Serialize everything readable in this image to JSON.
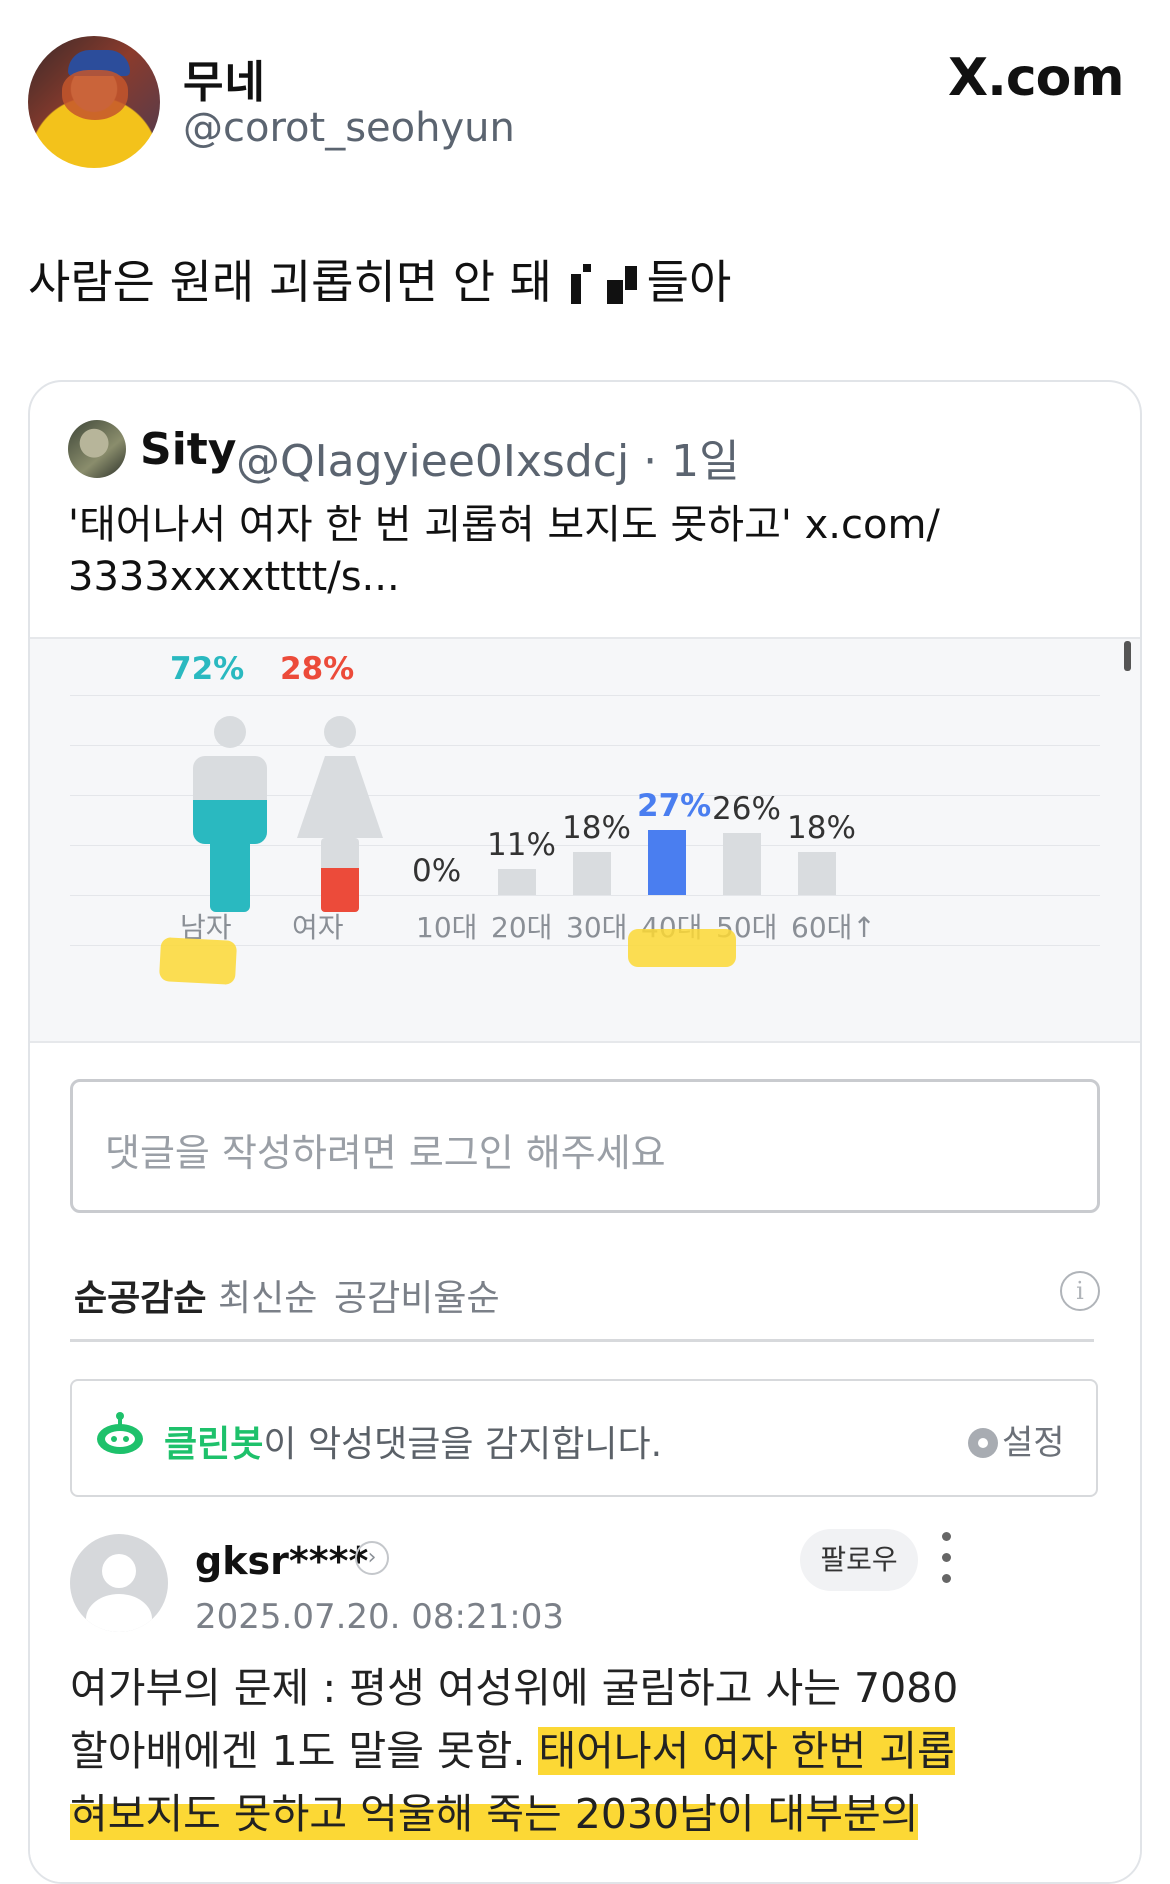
{
  "post": {
    "author_name": "무네",
    "author_handle": "@corot_seohyun",
    "site_label": "X.com",
    "text_before": "사람은 원래 괴롭히면 안 돼 ",
    "text_after": "들아"
  },
  "quote": {
    "name": "Sity",
    "handle_time": "@QIagyiee0Ixsdcj · 1일",
    "text_line1": "'태어나서 여자 한 번 괴롭혀 보지도 못하고' x.com/",
    "text_line2": "3333xxxxtttt/s..."
  },
  "chart_data": {
    "type": "bar",
    "gender": {
      "categories": [
        "남자",
        "여자"
      ],
      "values": [
        72,
        28
      ],
      "labels": [
        "72%",
        "28%"
      ],
      "colors": [
        "#2ab9c0",
        "#ec4b3a"
      ]
    },
    "age": {
      "categories": [
        "10대",
        "20대",
        "30대",
        "40대",
        "50대",
        "60대↑"
      ],
      "values": [
        0,
        11,
        18,
        27,
        26,
        18
      ],
      "labels": [
        "0%",
        "11%",
        "18%",
        "27%",
        "26%",
        "18%"
      ],
      "highlight_index": 3,
      "highlight_color": "#4a7ef0",
      "default_color": "#d9dcdf"
    }
  },
  "comments_ui": {
    "input_placeholder": "댓글을 작성하려면 로그인 해주세요",
    "sort_tabs": [
      "순공감순",
      "최신순",
      "공감비율순"
    ],
    "info_icon": "info-icon",
    "cleanbot_brand": "클린봇",
    "cleanbot_text": "이 악성댓글을 감지합니다.",
    "settings_label": "설정"
  },
  "comment": {
    "username": "gksr****",
    "timestamp": "2025.07.20. 08:21:03",
    "follow_label": "팔로우",
    "line1": "여가부의 문제 : 평생 여성위에 굴림하고 사는 7080",
    "line2_plain": "할아배에겐 1도 말을 못함. ",
    "line2_highlight": "태어나서 여자 한번 괴롭",
    "line3": "혀보지도 못하고 억울해 죽는 2030남이 대부분의"
  }
}
